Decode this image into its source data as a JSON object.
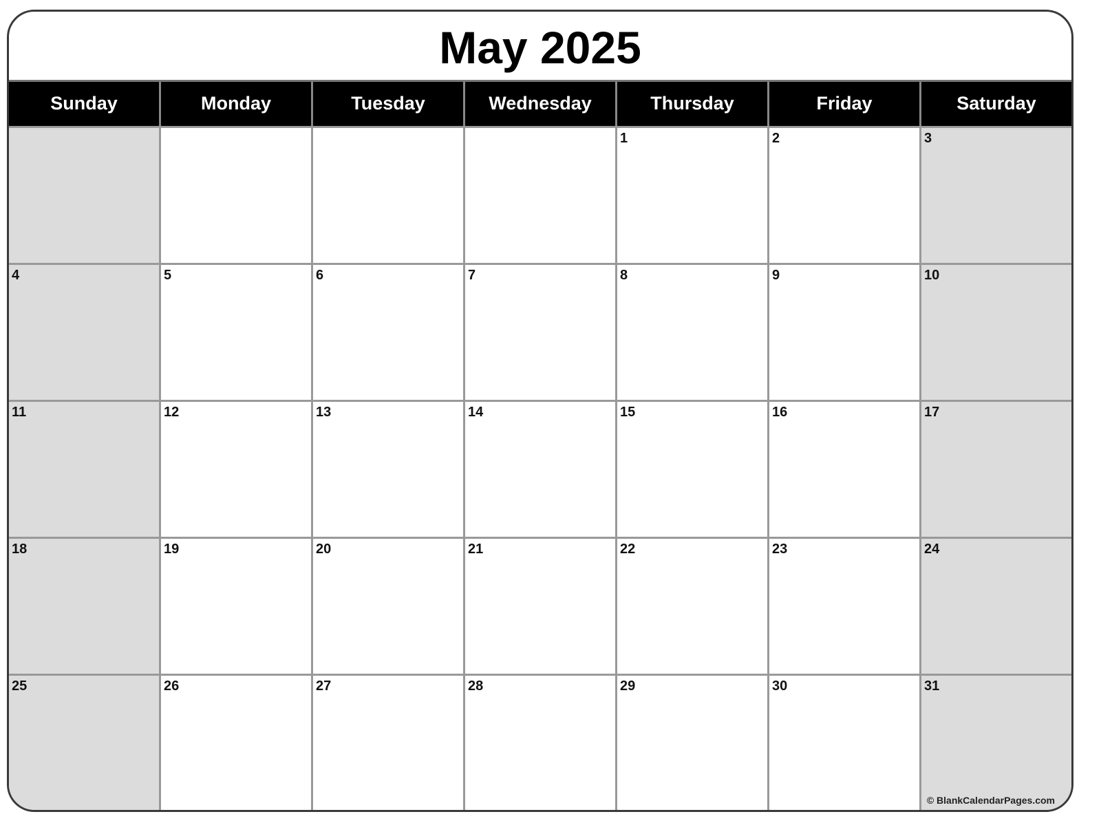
{
  "title": "May 2025",
  "weekdays": [
    "Sunday",
    "Monday",
    "Tuesday",
    "Wednesday",
    "Thursday",
    "Friday",
    "Saturday"
  ],
  "weeks": [
    [
      "",
      "",
      "",
      "",
      "1",
      "2",
      "3"
    ],
    [
      "4",
      "5",
      "6",
      "7",
      "8",
      "9",
      "10"
    ],
    [
      "11",
      "12",
      "13",
      "14",
      "15",
      "16",
      "17"
    ],
    [
      "18",
      "19",
      "20",
      "21",
      "22",
      "23",
      "24"
    ],
    [
      "25",
      "26",
      "27",
      "28",
      "29",
      "30",
      "31"
    ]
  ],
  "credit": "© BlankCalendarPages.com"
}
